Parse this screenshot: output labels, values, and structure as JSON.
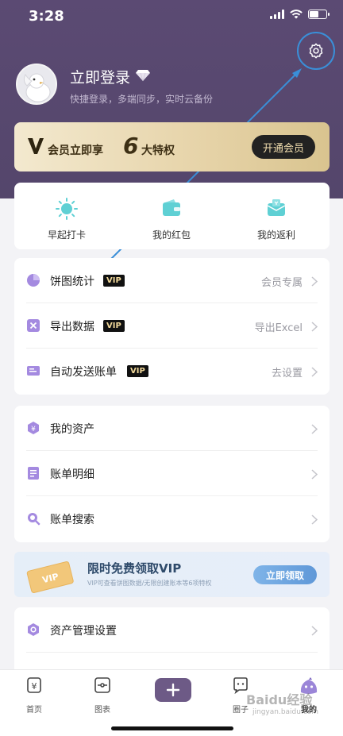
{
  "status_bar": {
    "time": "3:28"
  },
  "profile": {
    "login_title": "立即登录",
    "subtitle": "快捷登录，多端同步，实时云备份"
  },
  "vip_banner": {
    "text_before": "会员立即享",
    "big_number": "6",
    "text_after": "大特权",
    "button": "开通会员"
  },
  "quick_actions": [
    {
      "label": "早起打卡",
      "icon": "sun-icon"
    },
    {
      "label": "我的红包",
      "icon": "wallet-icon"
    },
    {
      "label": "我的返利",
      "icon": "rebate-icon"
    }
  ],
  "vip_features": [
    {
      "label": "饼图统计",
      "tag": "VIP",
      "right": "会员专属",
      "icon": "pie-chart-icon"
    },
    {
      "label": "导出数据",
      "tag": "VIP",
      "right": "导出Excel",
      "icon": "export-excel-icon"
    },
    {
      "label": "自动发送账单",
      "tag": "VIP",
      "right": "去设置",
      "icon": "email-bill-icon"
    }
  ],
  "asset_menu": [
    {
      "label": "我的资产",
      "icon": "asset-icon"
    },
    {
      "label": "账单明细",
      "icon": "bill-detail-icon"
    },
    {
      "label": "账单搜索",
      "icon": "search-icon"
    }
  ],
  "promo": {
    "title": "限时免费领取VIP",
    "subtitle": "VIP可查看饼图数据/无限创建账本等6项特权",
    "button": "立即领取",
    "ticket_text": "VIP"
  },
  "settings_menu": [
    {
      "label": "资产管理设置",
      "icon": "asset-settings-icon"
    }
  ],
  "tabbar": {
    "tabs": [
      {
        "label": "首页",
        "icon": "home-ledger-icon"
      },
      {
        "label": "图表",
        "icon": "chart-icon"
      },
      {
        "label": "",
        "icon": "add-icon"
      },
      {
        "label": "圈子",
        "icon": "community-icon"
      },
      {
        "label": "我的",
        "icon": "profile-icon"
      }
    ]
  },
  "watermark": {
    "text": "Baidu经验",
    "sub": "jingyan.baidu.com"
  },
  "colors": {
    "header": "#5b4a73",
    "accent_purple": "#8a6fc8",
    "vip_gold": "#f1d89a",
    "annotation_blue": "#3a8fd8"
  }
}
